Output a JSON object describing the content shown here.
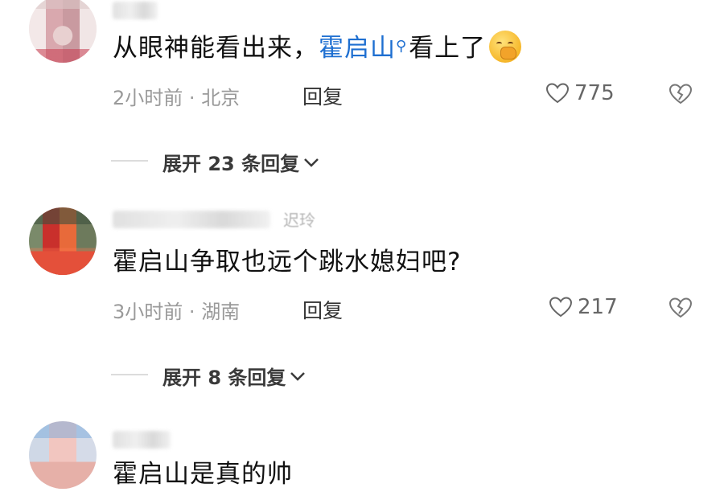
{
  "comments": [
    {
      "username": "",
      "text_before": "从眼神能看出来，",
      "mention": "霍启山",
      "text_after": "看上了",
      "emoji": "hand-over-mouth-emoji",
      "time": "2小时前",
      "location": "北京",
      "reply_label": "回复",
      "likes": "775",
      "expand_label": "展开 23 条回复"
    },
    {
      "username": "迟玲",
      "text": "霍启山争取也远个跳水媳妇吧?",
      "time": "3小时前",
      "location": "湖南",
      "reply_label": "回复",
      "likes": "217",
      "expand_label": "展开 8 条回复"
    },
    {
      "username": "",
      "text": "霍启山是真的帅"
    }
  ],
  "colors": {
    "mention": "#1e6fd1",
    "meta": "#9a9a9a",
    "text": "#111111"
  },
  "icons": [
    "heart-outline-icon",
    "broken-heart-icon",
    "chevron-down-icon",
    "search-icon"
  ]
}
